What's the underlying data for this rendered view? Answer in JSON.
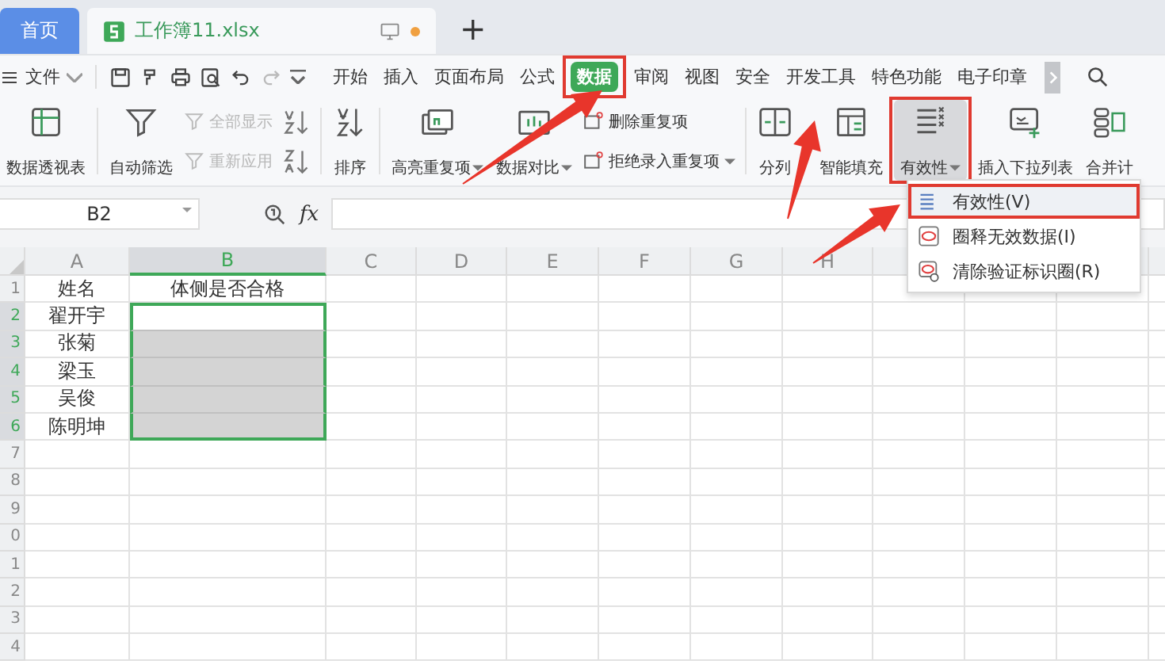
{
  "tabs": [
    {
      "label": "首页",
      "selected": false
    },
    {
      "label": "工作簿11.xlsx",
      "selected": true,
      "modified": true
    }
  ],
  "new_tab": "+",
  "menu": {
    "file": "文件",
    "tabs": [
      {
        "label": "开始",
        "selected": false
      },
      {
        "label": "插入",
        "selected": false
      },
      {
        "label": "页面布局",
        "selected": false
      },
      {
        "label": "公式",
        "selected": false
      },
      {
        "label": "数据",
        "selected": true,
        "annotated": true
      },
      {
        "label": "审阅",
        "selected": false
      },
      {
        "label": "视图",
        "selected": false
      },
      {
        "label": "安全",
        "selected": false
      },
      {
        "label": "开发工具",
        "selected": false
      },
      {
        "label": "特色功能",
        "selected": false
      },
      {
        "label": "电子印章",
        "selected": false
      }
    ]
  },
  "ribbon": [
    {
      "kind": "large",
      "label": "数据透视表"
    },
    {
      "kind": "large",
      "label": "自动筛选"
    },
    {
      "kind": "stack",
      "items": [
        {
          "label": "全部显示",
          "disabled": true
        },
        {
          "label": "重新应用",
          "disabled": true
        }
      ]
    },
    {
      "kind": "sort_icons"
    },
    {
      "kind": "large",
      "label": "排序"
    },
    {
      "kind": "large",
      "label": "高亮重复项",
      "dropdown": true
    },
    {
      "kind": "large",
      "label": "数据对比",
      "dropdown": true
    },
    {
      "kind": "stack",
      "items": [
        {
          "label": "删除重复项",
          "disabled": false
        },
        {
          "label": "拒绝录入重复项",
          "disabled": false,
          "dropdown": true
        }
      ]
    },
    {
      "kind": "large",
      "label": "分列"
    },
    {
      "kind": "large",
      "label": "智能填充"
    },
    {
      "kind": "large",
      "label": "有效性",
      "dropdown": true,
      "pressed": true,
      "annotated": true
    },
    {
      "kind": "large",
      "label": "插入下拉列表"
    },
    {
      "kind": "large",
      "label": "合并计"
    }
  ],
  "name_box": "B2",
  "fx": "fx",
  "sheet": {
    "columns": [
      {
        "label": "A",
        "selected": false
      },
      {
        "label": "B",
        "selected": true
      },
      {
        "label": "C",
        "selected": false
      },
      {
        "label": "D",
        "selected": false
      },
      {
        "label": "E",
        "selected": false
      },
      {
        "label": "F",
        "selected": false
      },
      {
        "label": "G",
        "selected": false
      },
      {
        "label": "H",
        "selected": false
      }
    ],
    "rows": [
      {
        "number": "1",
        "selected": false,
        "cells": [
          {
            "text": "姓名",
            "selected": false
          },
          {
            "text": "体侧是否合格",
            "selected": false
          }
        ]
      },
      {
        "number": "2",
        "selected": true,
        "cells": [
          {
            "text": "翟开宇",
            "selected": false
          },
          {
            "selected": true,
            "active": true
          }
        ]
      },
      {
        "number": "3",
        "selected": true,
        "cells": [
          {
            "text": "张菊",
            "selected": false
          },
          {
            "selected": true,
            "active": false
          }
        ]
      },
      {
        "number": "4",
        "selected": true,
        "cells": [
          {
            "text": "梁玉",
            "selected": false
          },
          {
            "selected": true,
            "active": false
          }
        ]
      },
      {
        "number": "5",
        "selected": true,
        "cells": [
          {
            "text": "吴俊",
            "selected": false
          },
          {
            "selected": true,
            "active": false
          }
        ]
      },
      {
        "number": "6",
        "selected": true,
        "cells": [
          {
            "text": "陈明坤",
            "selected": false
          },
          {
            "selected": true,
            "active": false
          }
        ]
      },
      {
        "number": "7",
        "selected": false,
        "cells": []
      },
      {
        "number": "8",
        "selected": false,
        "cells": []
      },
      {
        "number": "9",
        "selected": false,
        "cells": []
      },
      {
        "number": "0",
        "selected": false,
        "cells": []
      },
      {
        "number": "1",
        "selected": false,
        "cells": []
      },
      {
        "number": "2",
        "selected": false,
        "cells": []
      },
      {
        "number": "3",
        "selected": false,
        "cells": []
      },
      {
        "number": "4",
        "selected": false,
        "cells": []
      }
    ]
  },
  "dropdown_menu": [
    {
      "label": "有效性(V)",
      "selected": true,
      "annotated": true
    },
    {
      "label": "圈释无效数据(I)",
      "selected": false
    },
    {
      "label": "清除验证标识圈(R)",
      "selected": false
    }
  ]
}
